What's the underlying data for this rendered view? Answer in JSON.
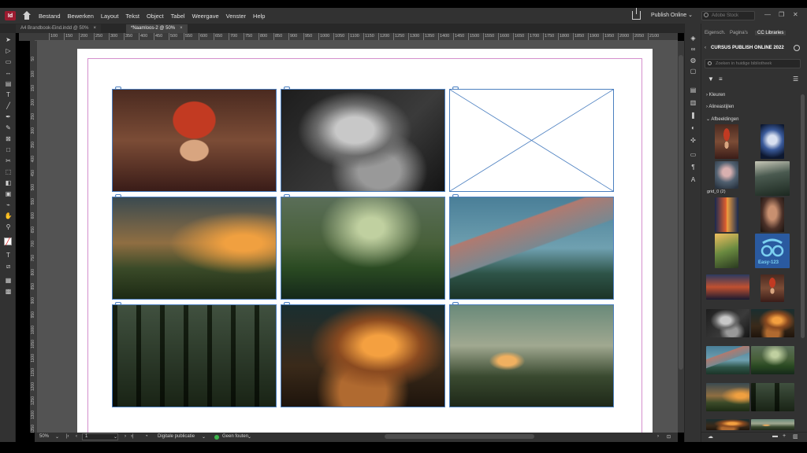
{
  "menubar": {
    "app_icon": "Id",
    "items": [
      "Bestand",
      "Bewerken",
      "Layout",
      "Tekst",
      "Object",
      "Tabel",
      "Weergave",
      "Venster",
      "Help"
    ],
    "publish_online": "Publish Online",
    "search_placeholder": "Adobe Stock",
    "window_controls": [
      "—",
      "❐",
      "✕"
    ]
  },
  "tabs": [
    {
      "label": "A4 Brandbook-Eind.indd @ 50%",
      "close": "×"
    },
    {
      "label": "*Naamloos-2 @ 50%",
      "close": "×"
    }
  ],
  "ruler_top": [
    "100",
    "150",
    "200",
    "250",
    "300",
    "350",
    "400",
    "450",
    "500",
    "550",
    "600",
    "650",
    "700",
    "750",
    "800",
    "850",
    "900",
    "950",
    "1000",
    "1050",
    "1100",
    "1150",
    "1200",
    "1250",
    "1300",
    "1350",
    "1400",
    "1450",
    "1500",
    "1550",
    "1600",
    "1650",
    "1700",
    "1750",
    "1800",
    "1850",
    "1900",
    "1950",
    "2000",
    "2050",
    "2100"
  ],
  "ruler_left": [
    "50",
    "100",
    "150",
    "200",
    "250",
    "300",
    "350",
    "400",
    "450",
    "500",
    "550",
    "600",
    "650",
    "700",
    "750",
    "800",
    "850",
    "900",
    "950",
    "1000",
    "1050",
    "1100",
    "1150",
    "1200",
    "1250",
    "1300",
    "1350"
  ],
  "statusbar": {
    "zoom": "50%",
    "page": "1",
    "preflight_profile": "Digitale publicatie",
    "errors": "Geen fouten"
  },
  "panel": {
    "tabs": [
      "Eigensch.",
      "Pagina's",
      "CC Libraries"
    ],
    "library_name": "CURSUS PUBLISH ONLINE 2022",
    "search_placeholder": "Zoeken in huidige bibliotheek",
    "sections": [
      "Kleuren",
      "Alineastijlen",
      "Afbeeldingen"
    ],
    "thumb_label": "grid_0 (2)",
    "logo_text": "Easy-123"
  },
  "colors": {
    "frame": "#4b7fc0",
    "margin_guide": "#d48fcd",
    "status_ok": "#3bb44a"
  }
}
